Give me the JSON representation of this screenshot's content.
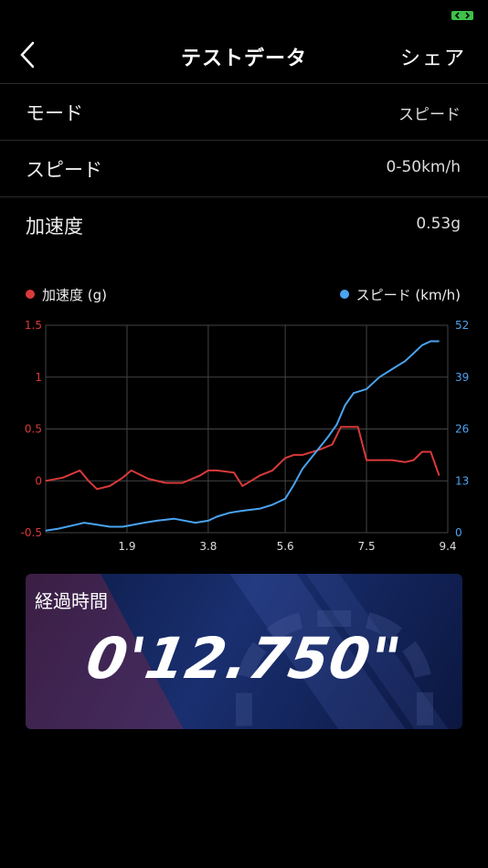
{
  "header": {
    "title": "テストデータ",
    "share_label": "シェア"
  },
  "rows": [
    {
      "label": "モード",
      "value": "スピード"
    },
    {
      "label": "スピード",
      "value": "0-50km/h"
    },
    {
      "label": "加速度",
      "value": "0.53g"
    }
  ],
  "legend": {
    "accel": "加速度 (g)",
    "speed": "スピード (km/h)"
  },
  "colors": {
    "accel": "#d93a3a",
    "speed": "#4aa3f0",
    "grid": "#444444"
  },
  "chart_data": {
    "type": "line",
    "x_ticks": [
      "1.9",
      "3.8",
      "5.6",
      "7.5",
      "9.4"
    ],
    "x_range": [
      0,
      9.4
    ],
    "y_left_ticks": [
      "1.5",
      "1",
      "0.5",
      "0",
      "-0.5"
    ],
    "y_left_range": [
      -0.5,
      1.5
    ],
    "y_right_ticks": [
      "52",
      "39",
      "26",
      "13",
      "0"
    ],
    "y_right_range": [
      0,
      52
    ],
    "grid": true,
    "series": [
      {
        "name": "加速度 (g)",
        "axis": "left",
        "x": [
          0,
          0.4,
          0.8,
          1.0,
          1.2,
          1.5,
          1.8,
          2.0,
          2.4,
          2.8,
          3.2,
          3.6,
          3.8,
          4.0,
          4.4,
          4.6,
          4.8,
          5.0,
          5.3,
          5.6,
          5.8,
          6.0,
          6.4,
          6.7,
          6.9,
          7.1,
          7.3,
          7.5,
          7.8,
          8.1,
          8.4,
          8.6,
          8.8,
          9.0,
          9.2
        ],
        "y": [
          0,
          0.03,
          0.1,
          0,
          -0.08,
          -0.05,
          0.03,
          0.1,
          0.02,
          -0.02,
          -0.02,
          0.05,
          0.1,
          0.1,
          0.08,
          -0.05,
          0,
          0.05,
          0.1,
          0.22,
          0.25,
          0.25,
          0.3,
          0.35,
          0.52,
          0.52,
          0.52,
          0.2,
          0.2,
          0.2,
          0.18,
          0.2,
          0.28,
          0.28,
          0.05
        ]
      },
      {
        "name": "スピード (km/h)",
        "axis": "right",
        "x": [
          0,
          0.3,
          0.7,
          0.9,
          1.2,
          1.5,
          1.8,
          2.3,
          2.6,
          3.0,
          3.5,
          3.8,
          4.0,
          4.3,
          4.6,
          5.0,
          5.3,
          5.6,
          5.8,
          6.0,
          6.3,
          6.6,
          6.8,
          7.0,
          7.2,
          7.5,
          7.8,
          8.1,
          8.4,
          8.6,
          8.8,
          9.0,
          9.2
        ],
        "y": [
          0.5,
          1,
          2,
          2.5,
          2,
          1.5,
          1.5,
          2.5,
          3,
          3.5,
          2.5,
          3,
          4,
          5,
          5.5,
          6,
          7,
          8.5,
          12,
          16,
          20,
          24,
          27,
          32,
          35,
          36,
          39,
          41,
          43,
          45,
          47,
          48,
          48
        ]
      }
    ]
  },
  "timer": {
    "label": "経過時間",
    "value": "0'12.750\""
  }
}
